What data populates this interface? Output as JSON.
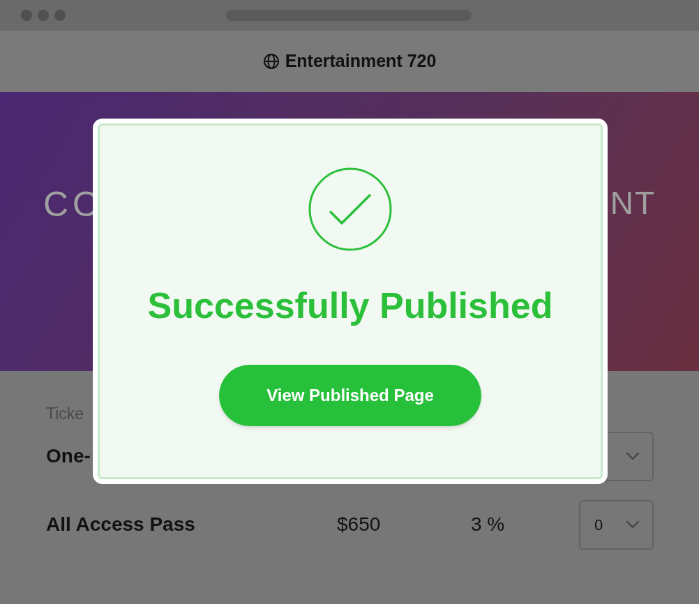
{
  "site": {
    "title": "Entertainment 720"
  },
  "hero": {
    "text_left": "CO",
    "text_right": "NT"
  },
  "tickets": {
    "label": "Ticke",
    "rows": [
      {
        "name": "One-"
      },
      {
        "name": "All Access Pass",
        "price": "$650",
        "fee": "3 %",
        "quantity": "0"
      }
    ]
  },
  "modal": {
    "title": "Successfully Published",
    "button": "View Published Page"
  }
}
